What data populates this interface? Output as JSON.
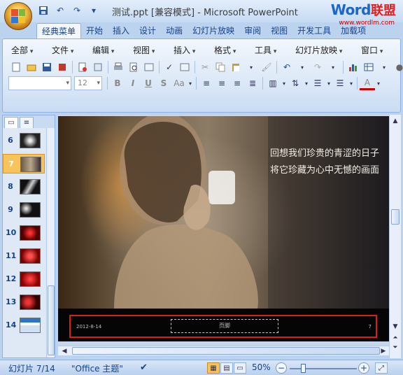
{
  "window": {
    "title": "测试.ppt [兼容模式] - Microsoft PowerPoint",
    "brand": {
      "word": "Word",
      "cn": "联盟",
      "url": "www.wordlm.com"
    }
  },
  "qat": {
    "icons": [
      "save-icon",
      "undo-icon",
      "redo-icon"
    ]
  },
  "tabs": [
    "经典菜单",
    "开始",
    "插入",
    "设计",
    "动画",
    "幻灯片放映",
    "审阅",
    "视图",
    "开发工具",
    "加载项"
  ],
  "menus": [
    "全部",
    "文件",
    "编辑",
    "视图",
    "插入",
    "格式",
    "工具",
    "幻灯片放映",
    "窗口"
  ],
  "font": {
    "name": "",
    "size": "12"
  },
  "format_buttons": [
    "B",
    "I",
    "U",
    "S",
    "Aa"
  ],
  "slides": [
    {
      "num": "6"
    },
    {
      "num": "7"
    },
    {
      "num": "8"
    },
    {
      "num": "9"
    },
    {
      "num": "10"
    },
    {
      "num": "11"
    },
    {
      "num": "12"
    },
    {
      "num": "13"
    },
    {
      "num": "14"
    }
  ],
  "active_slide": "7",
  "slide_content": {
    "line1": "回想我们珍贵的青涩的日子",
    "line2": "将它珍藏为心中无憾的画面",
    "footer_date": "2012-8-14",
    "footer_center": "页脚",
    "footer_page": "7"
  },
  "status": {
    "slide_info": "幻灯片 7/14",
    "theme": "\"Office 主题\"",
    "zoom": "50%",
    "zoom_level": 0.5
  },
  "colors": {
    "accent": "#f7c35b",
    "highlight_frame": "#d62020",
    "ribbon": "#dbe8f7"
  }
}
